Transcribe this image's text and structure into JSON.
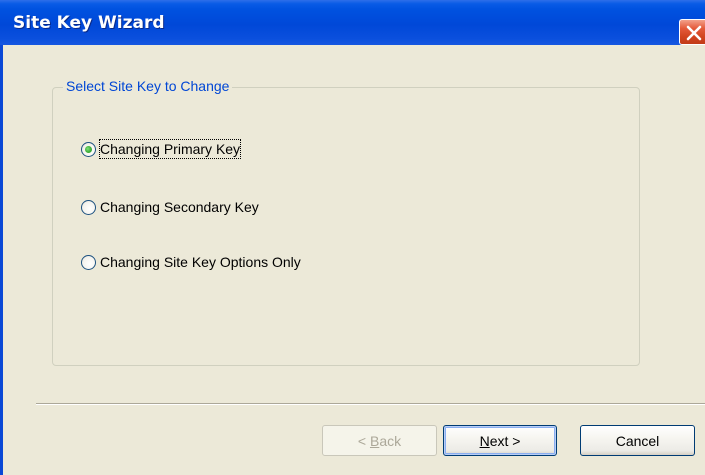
{
  "window": {
    "title": "Site Key Wizard",
    "close_icon": "close-x-icon"
  },
  "group": {
    "legend": "Select Site Key to Change",
    "options": [
      {
        "label": "Changing Primary Key",
        "checked": true
      },
      {
        "label": "Changing Secondary Key",
        "checked": false
      },
      {
        "label": "Changing Site Key Options Only",
        "checked": false
      }
    ]
  },
  "buttons": {
    "back": {
      "prefix": "< ",
      "mnemonic": "B",
      "rest": "ack",
      "enabled": false
    },
    "next": {
      "mnemonic": "N",
      "rest": "ext >",
      "enabled": true
    },
    "cancel": {
      "label": "Cancel",
      "enabled": true
    }
  },
  "colors": {
    "titlebar": "#0050DD",
    "dialog_background": "#ECE9D8",
    "legend_text": "#0046D5",
    "close_button": "#D1441F"
  }
}
